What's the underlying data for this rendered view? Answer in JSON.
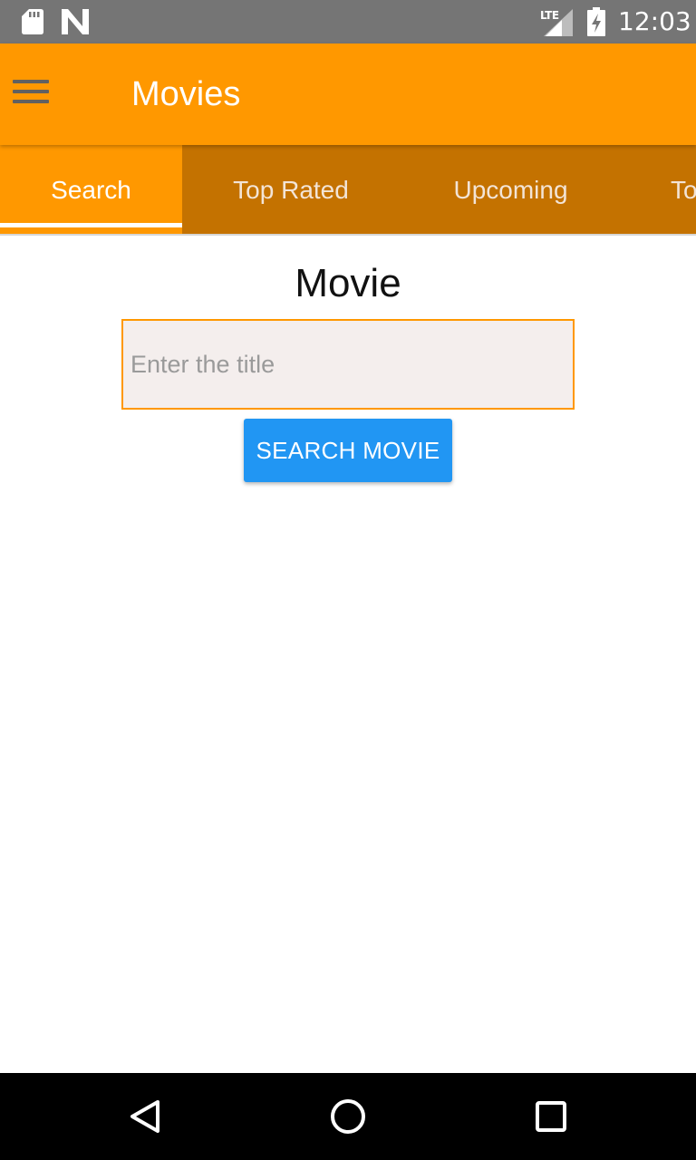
{
  "status_bar": {
    "time": "12:03",
    "network": "LTE",
    "icons": [
      "sd-card-icon",
      "n-notification-icon",
      "signal-icon",
      "battery-icon"
    ]
  },
  "app_bar": {
    "title": "Movies",
    "menu_icon": "hamburger-menu-icon"
  },
  "tabs": [
    {
      "label": "Search",
      "active": true
    },
    {
      "label": "Top Rated",
      "active": false
    },
    {
      "label": "Upcoming",
      "active": false
    },
    {
      "label": "To",
      "active": false
    }
  ],
  "content": {
    "heading": "Movie",
    "input_placeholder": "Enter the title",
    "input_value": "",
    "search_button_label": "SEARCH MOVIE"
  },
  "nav_bar": {
    "icons": [
      "back-icon",
      "home-icon",
      "recents-icon"
    ]
  },
  "colors": {
    "primary": "#ff9800",
    "tab_background": "#c47200",
    "accent_button": "#2196f3",
    "input_background": "#f4eeed"
  }
}
